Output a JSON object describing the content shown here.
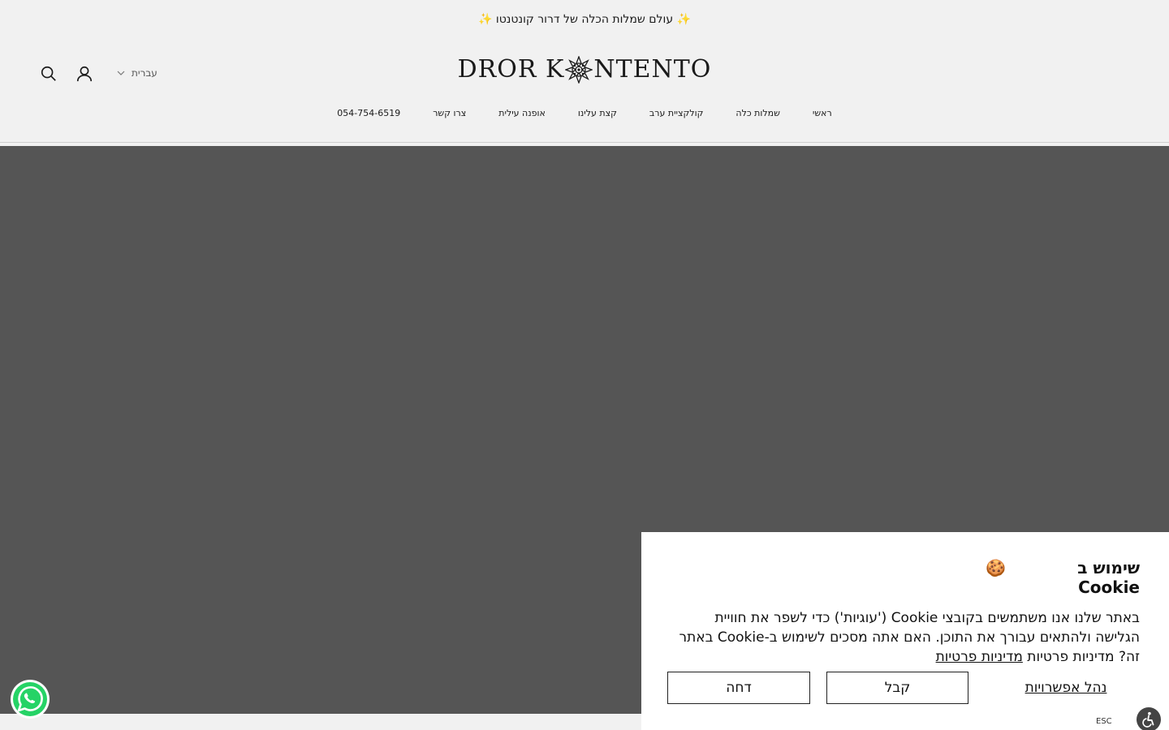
{
  "announcement": {
    "text": "✨ עולם שמלות הכלה של דרור קונטנטו ✨"
  },
  "header": {
    "logo_left": "DROR K",
    "logo_right": "NTENTO",
    "language": "עברית"
  },
  "nav": {
    "items": [
      {
        "label": "ראשי"
      },
      {
        "label": "שמלות כלה"
      },
      {
        "label": "קולקציית ערב"
      },
      {
        "label": "קצת עלינו"
      },
      {
        "label": "אופנה עילית"
      },
      {
        "label": "צרו קשר"
      },
      {
        "label": "054-754-6519"
      }
    ]
  },
  "cookie": {
    "title_text": "שימוש ב Cookie",
    "title_emoji": "🍪",
    "body": "באתר שלנו אנו משתמשים בקובצי Cookie ('עוגיות') כדי לשפר את חוויית הגלישה ולהתאים עבורך את התוכן. האם אתה מסכים לשימוש ב-Cookie באתר זה? מדיניות פרטיות ",
    "policy_link": "מדיניות פרטיות",
    "manage_label": "נהל אפשרויות",
    "accept_label": "קבל",
    "reject_label": "דחה",
    "esc_label": "ESC"
  },
  "colors": {
    "background": "#f1f1f1",
    "hero": "#555555",
    "whatsapp_green": "#25D366"
  },
  "icons": {
    "search": "search-icon",
    "account": "user-icon",
    "language_chevron": "chevron-down-icon",
    "whatsapp": "whatsapp-icon",
    "accessibility": "accessibility-icon"
  }
}
